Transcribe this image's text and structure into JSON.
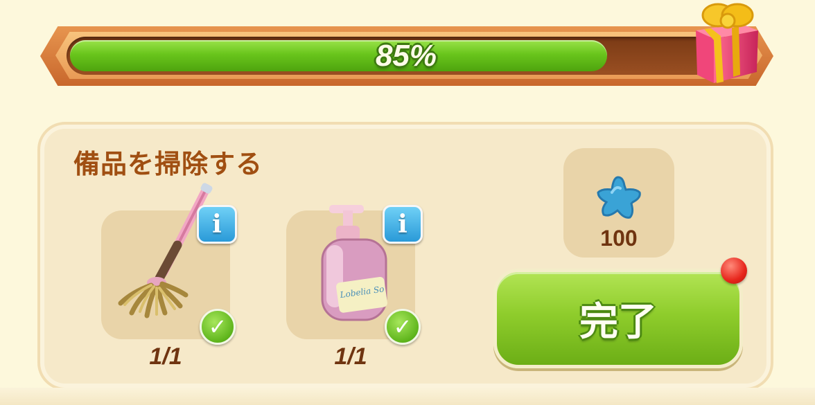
{
  "progress": {
    "percent": 85,
    "label": "85%"
  },
  "quest": {
    "title": "備品を掃除する",
    "items": [
      {
        "icon": "mop-icon",
        "count": "1/1",
        "completed": true
      },
      {
        "icon": "soap-bottle-icon",
        "count": "1/1",
        "completed": true,
        "bottle_text": "Lobelia So"
      }
    ],
    "reward": {
      "icon": "blue-star-icon",
      "amount": "100"
    },
    "complete_button_label": "完了"
  },
  "colors": {
    "progress_green": "#69c51c",
    "frame_orange": "#c8672c",
    "title_brown": "#a04f12",
    "button_green": "#8fcd2c",
    "notification_red": "#e7261c",
    "info_blue": "#2a9ad8"
  }
}
